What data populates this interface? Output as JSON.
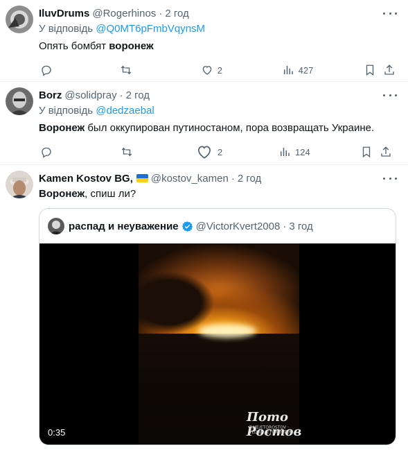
{
  "tweets": [
    {
      "name": "IluvDrums",
      "handle": "@Rogerhinos",
      "dot": "·",
      "time": "2 год",
      "reply_prefix": "У відповідь",
      "reply_to": "@Q0MT6pFmbVqynsM",
      "text_before": "Опять бомбят ",
      "text_bold": "воронеж",
      "text_after": "",
      "likes": "2",
      "views": "427"
    },
    {
      "name": "Borz",
      "handle": "@solidpray",
      "dot": "·",
      "time": "2 год",
      "reply_prefix": "У відповідь",
      "reply_to": "@dedzaebal",
      "text_before": "",
      "text_bold": "Воронеж",
      "text_after": " был оккупирован путиностаном, пора возвращать Украине.",
      "likes": "2",
      "views": "124"
    },
    {
      "name": "Kamen Kostov BG,",
      "handle": "@kostov_kamen",
      "dot": "·",
      "time": "2 год",
      "text_before": "",
      "text_bold": "Воронеж",
      "text_after": ", спиш ли?",
      "quote": {
        "name": "распад и неуважение",
        "handle": "@VictorKvert2008",
        "dot": "·",
        "time": "3 год",
        "duration": "0:35",
        "watermark": "Пото Ростов",
        "watermark_sub": "T.ME/ETOROSTOV · YLDRM: ETOROSTOV"
      }
    }
  ],
  "icons": {
    "reply": "reply-icon",
    "retweet": "retweet-icon",
    "like": "like-icon",
    "views": "views-icon",
    "bookmark": "bookmark-icon",
    "share": "share-icon",
    "more": "more-icon",
    "verified": "verified-badge-icon",
    "flag": "ukraine-flag-icon"
  },
  "colors": {
    "link": "#1d9bf0",
    "secondary": "#536471",
    "verified": "#1d9bf0"
  }
}
